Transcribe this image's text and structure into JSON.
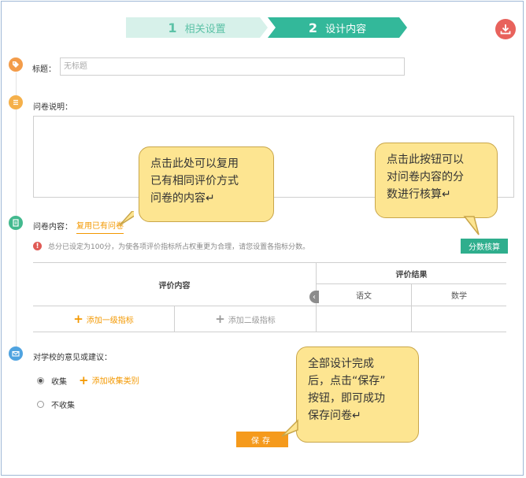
{
  "steps": [
    {
      "num": "1",
      "label": "相关设置"
    },
    {
      "num": "2",
      "label": "设计内容"
    }
  ],
  "icons": {
    "download": "download-icon",
    "title": "tag-icon",
    "description": "list-icon",
    "content": "document-icon",
    "suggestion": "mail-icon"
  },
  "colors": {
    "accent_green": "#33b89a",
    "accent_orange": "#f39800",
    "callout_bg": "#fde591"
  },
  "form": {
    "title_label": "标题：",
    "title_placeholder": "无标题",
    "description_label": "问卷说明：",
    "content_label": "问卷内容：",
    "reuse_link": "复用已有问卷",
    "warning": "总分已设定为100分，为使各项评价指标所占权重更为合理，请您设置各指标分数。",
    "score_button": "分数核算"
  },
  "table": {
    "eval_content": "评价内容",
    "eval_result": "评价结果",
    "subjects": [
      "语文",
      "数学"
    ],
    "add_level1": "添加一级指标",
    "add_level2": "添加二级指标"
  },
  "suggestions": {
    "label": "对学校的意见或建议：",
    "option_collect": "收集",
    "add_category": "添加收集类别",
    "option_no_collect": "不收集",
    "selected": "收集"
  },
  "save_button": "保存",
  "callouts": {
    "reuse_tip_lines": [
      "点击此处可以复用",
      "已有相同评价方式",
      "问卷的内容↵"
    ],
    "score_tip_lines": [
      "点击此按钮可以",
      "对问卷内容的分",
      "数进行核算↵"
    ],
    "save_tip_lines": [
      "全部设计完成",
      "后，点击“保存”",
      "按钮，即可成功",
      "保存问卷↵"
    ]
  }
}
